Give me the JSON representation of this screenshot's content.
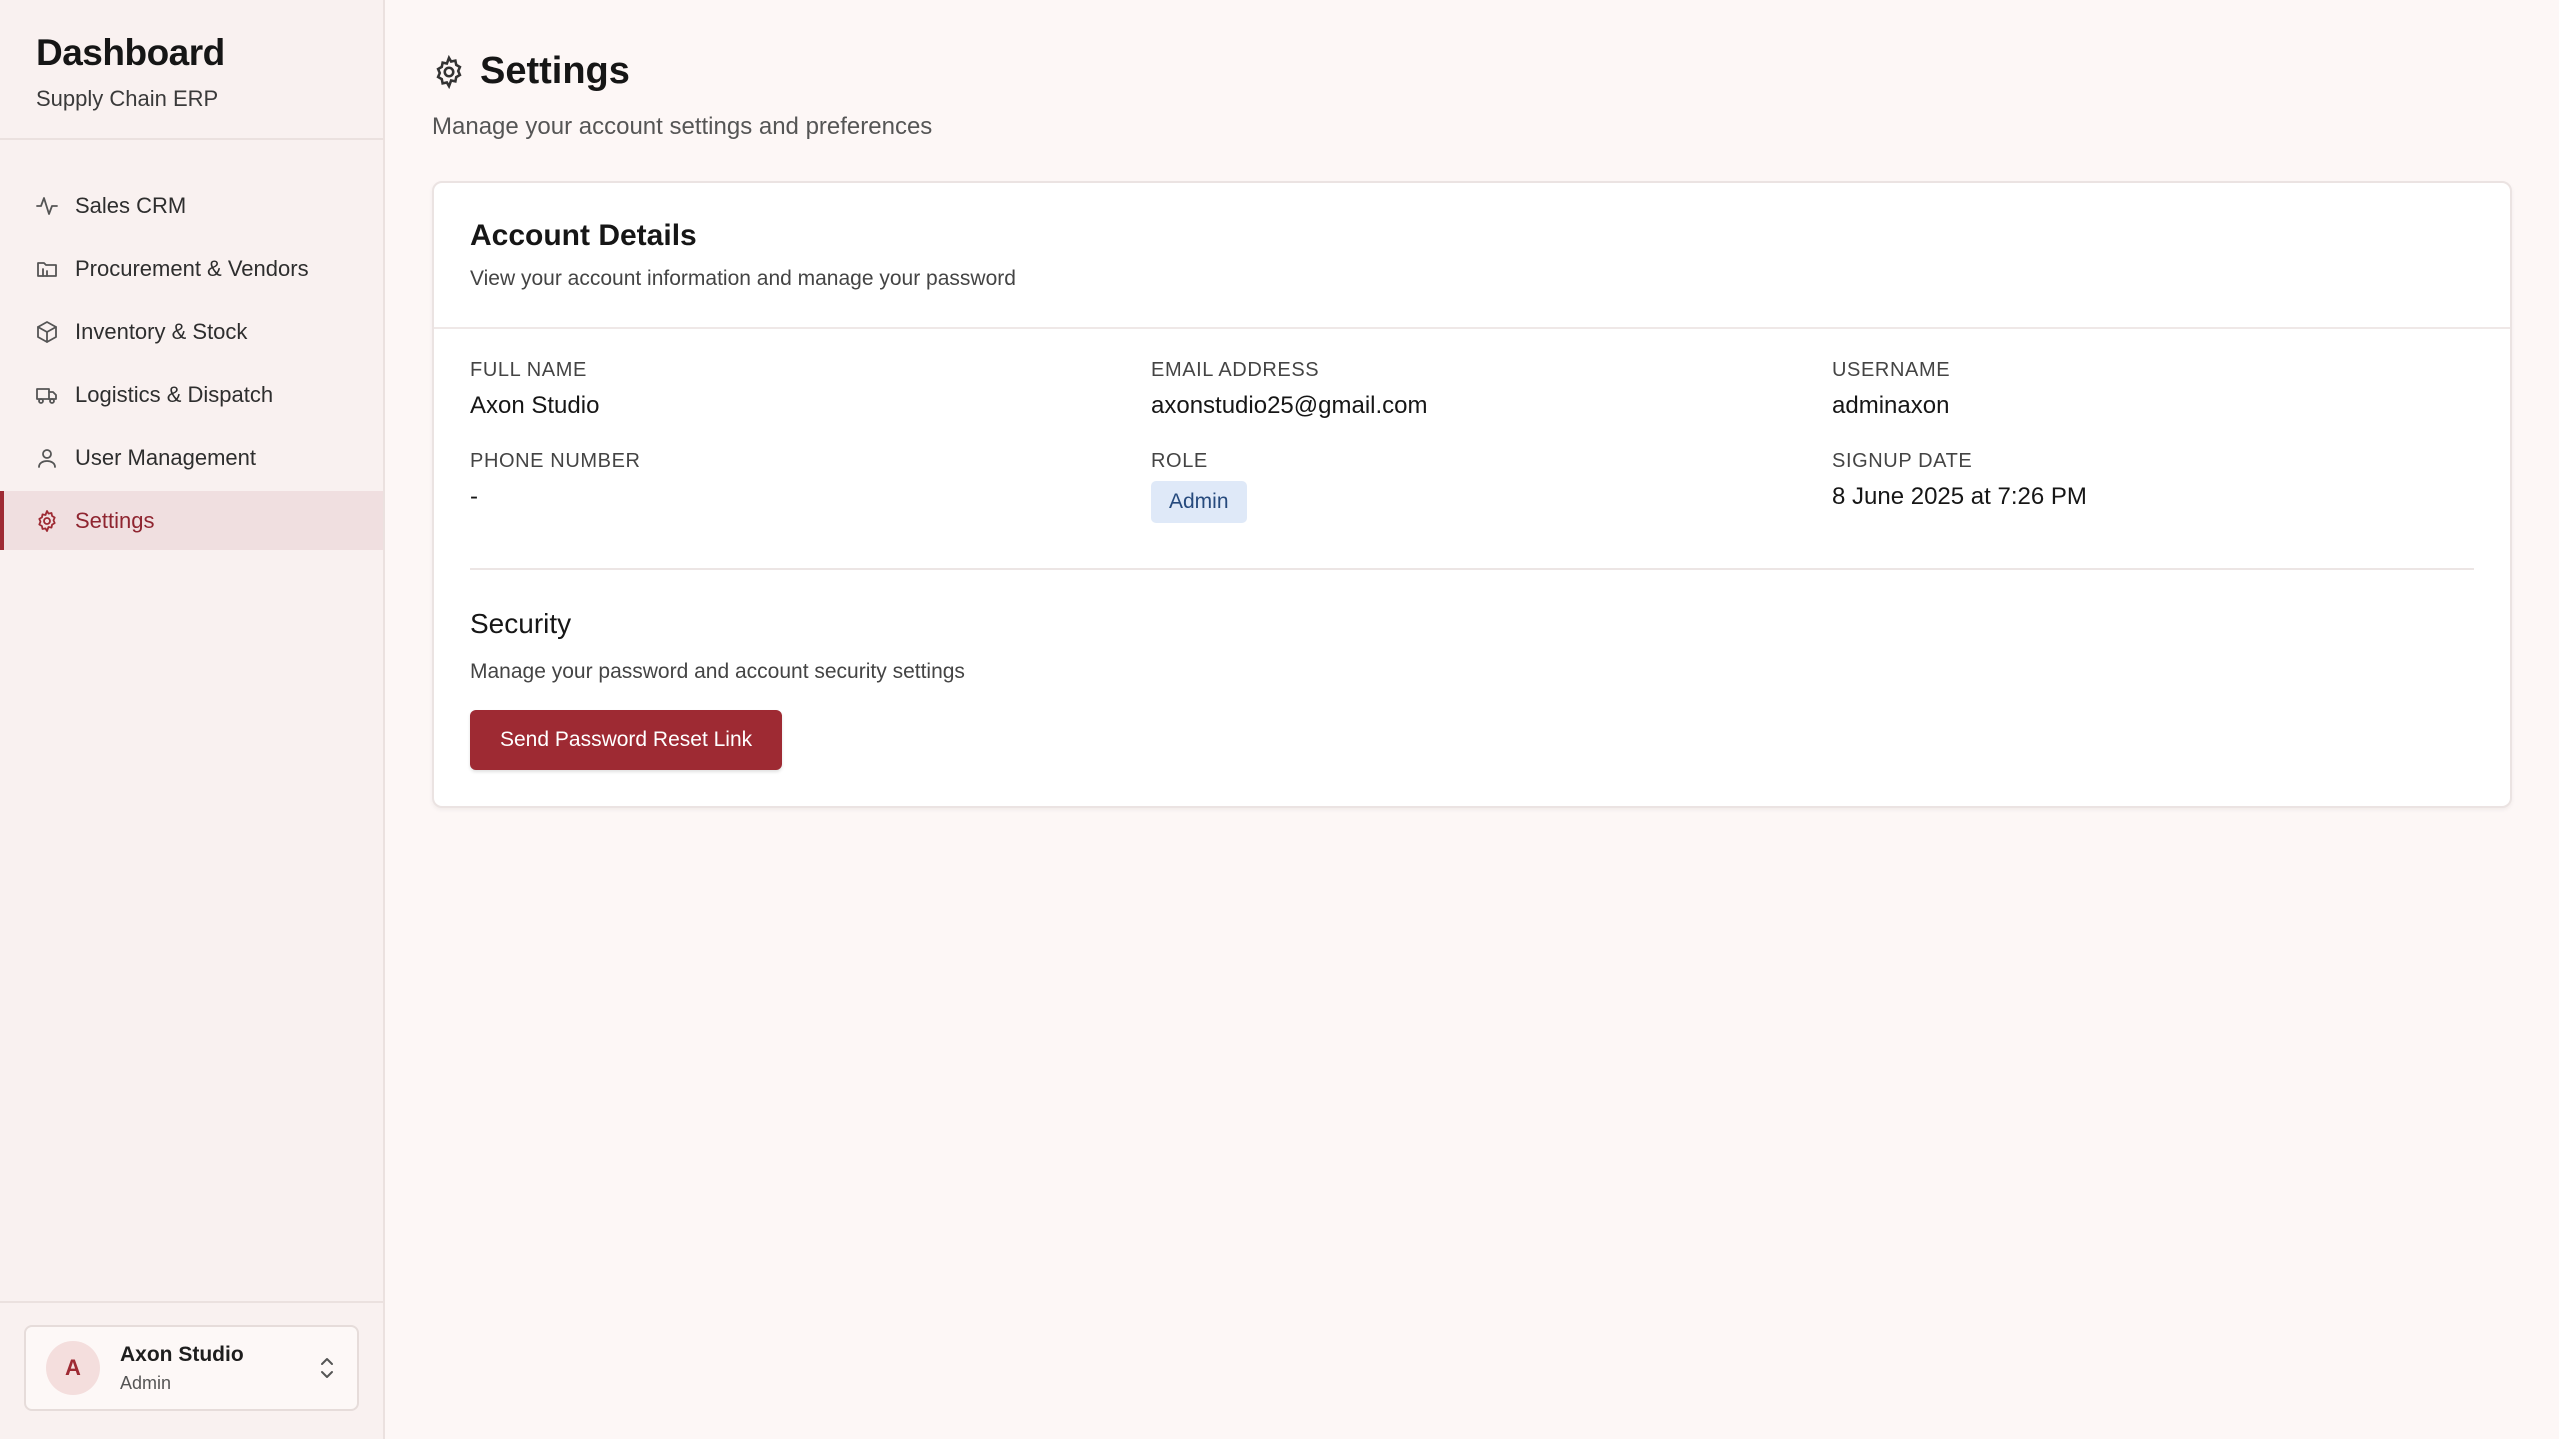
{
  "sidebar": {
    "brand_title": "Dashboard",
    "brand_subtitle": "Supply Chain ERP",
    "items": [
      {
        "label": "Sales CRM",
        "icon": "activity-icon"
      },
      {
        "label": "Procurement & Vendors",
        "icon": "folder-icon"
      },
      {
        "label": "Inventory & Stock",
        "icon": "box-icon"
      },
      {
        "label": "Logistics & Dispatch",
        "icon": "truck-icon"
      },
      {
        "label": "User Management",
        "icon": "user-icon"
      },
      {
        "label": "Settings",
        "icon": "gear-icon",
        "active": true
      }
    ],
    "user": {
      "initial": "A",
      "name": "Axon Studio",
      "role": "Admin"
    }
  },
  "header": {
    "title": "Settings",
    "subtitle": "Manage your account settings and preferences"
  },
  "account": {
    "title": "Account Details",
    "subtitle": "View your account information and manage your password",
    "fields": {
      "full_name_label": "FULL NAME",
      "full_name": "Axon Studio",
      "email_label": "EMAIL ADDRESS",
      "email": "axonstudio25@gmail.com",
      "username_label": "USERNAME",
      "username": "adminaxon",
      "phone_label": "PHONE NUMBER",
      "phone": "-",
      "role_label": "ROLE",
      "role": "Admin",
      "signup_label": "SIGNUP DATE",
      "signup": "8 June 2025 at 7:26 PM"
    }
  },
  "security": {
    "title": "Security",
    "subtitle": "Manage your password and account security settings",
    "button_label": "Send Password Reset Link"
  },
  "colors": {
    "accent": "#9e2a33",
    "active_bg": "#f0dfe0",
    "badge_bg": "#dfe9f8",
    "badge_text": "#264a7d"
  }
}
